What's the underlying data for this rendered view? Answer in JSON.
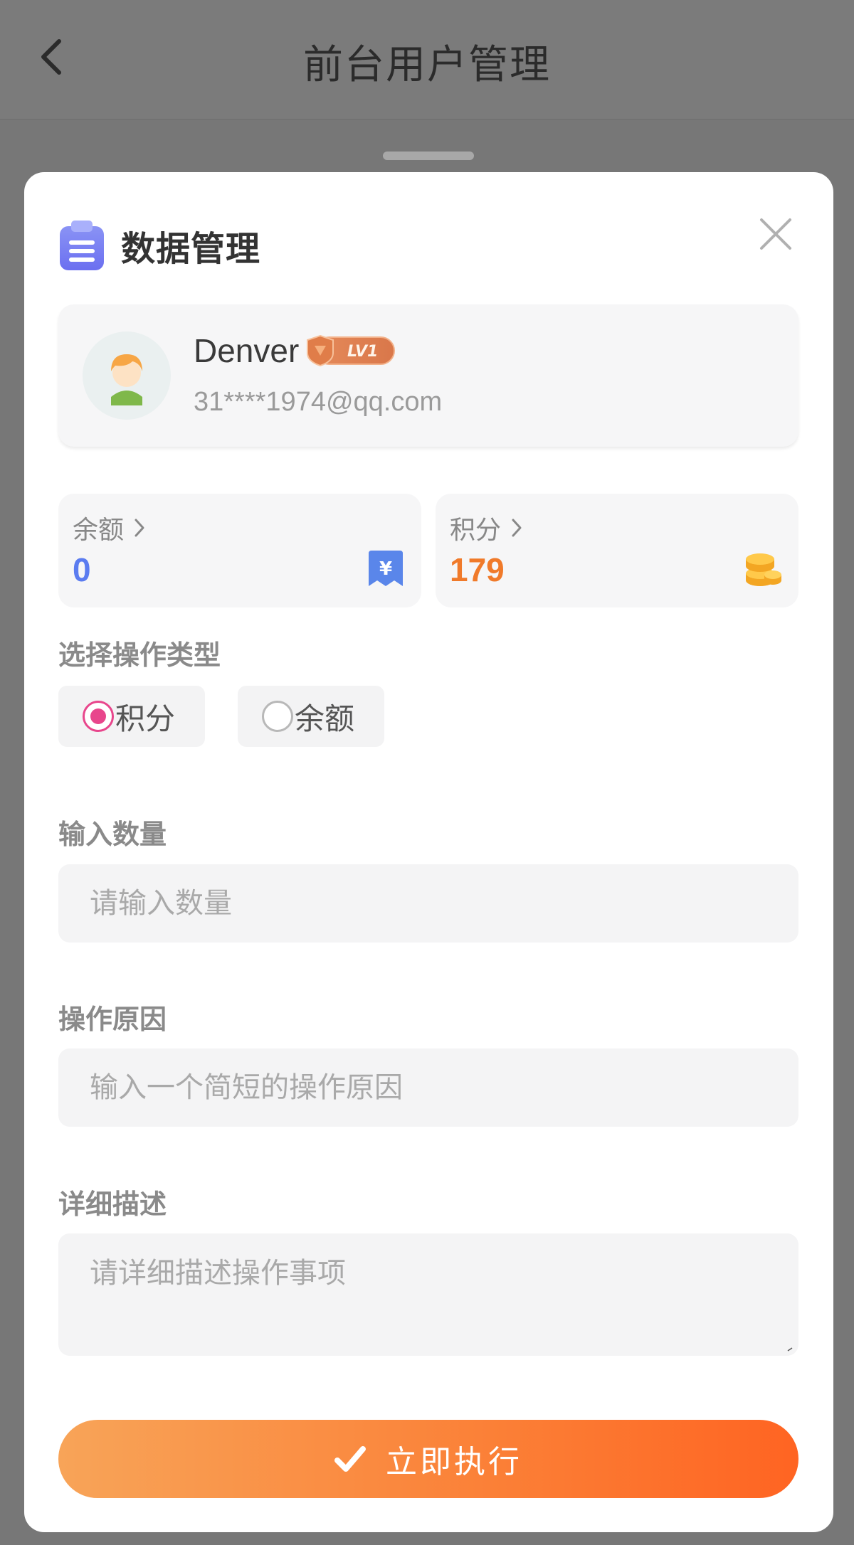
{
  "header": {
    "title": "前台用户管理",
    "back_icon": "chevron-left-icon"
  },
  "sheet": {
    "title": "数据管理",
    "title_icon": "clipboard-icon",
    "close_icon": "close-icon"
  },
  "user": {
    "name": "Denver",
    "level": "LV1",
    "email": "31****1974@qq.com"
  },
  "stats": {
    "balance": {
      "label": "余额",
      "value": "0",
      "icon": "yuan-ticket-icon",
      "color": "#5b7cf0"
    },
    "points": {
      "label": "积分",
      "value": "179",
      "icon": "coins-icon",
      "color": "#f07a2a"
    }
  },
  "operation": {
    "label": "选择操作类型",
    "options": [
      {
        "label": "积分",
        "selected": true
      },
      {
        "label": "余额",
        "selected": false
      }
    ],
    "accent": "#e8468c"
  },
  "quantity": {
    "label": "输入数量",
    "placeholder": "请输入数量",
    "value": ""
  },
  "reason": {
    "label": "操作原因",
    "placeholder": "输入一个简短的操作原因",
    "value": ""
  },
  "description": {
    "label": "详细描述",
    "placeholder": "请详细描述操作事项",
    "value": ""
  },
  "submit": {
    "label": "立即执行",
    "icon": "checkmark-icon"
  }
}
